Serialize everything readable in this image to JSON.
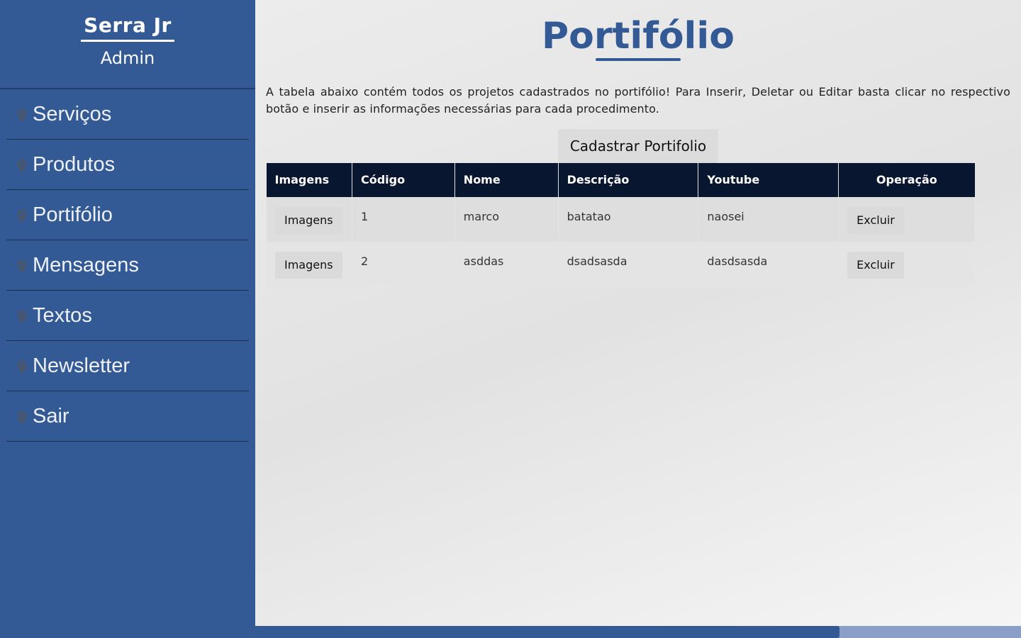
{
  "sidebar": {
    "brand": "Serra Jr",
    "role": "Admin",
    "items": [
      {
        "label": "Serviços",
        "icon": "map-pin-icon"
      },
      {
        "label": "Produtos",
        "icon": "map-pin-icon"
      },
      {
        "label": "Portifólio",
        "icon": "map-pin-icon"
      },
      {
        "label": "Mensagens",
        "icon": "map-pin-icon"
      },
      {
        "label": "Textos",
        "icon": "map-pin-icon"
      },
      {
        "label": "Newsletter",
        "icon": "map-pin-icon"
      },
      {
        "label": "Sair",
        "icon": "map-pin-icon"
      }
    ]
  },
  "main": {
    "title": "Portifólio",
    "intro": "A tabela abaixo contém todos os projetos cadastrados no portifólio! Para Inserir, Deletar ou Editar basta clicar no respectivo botão e inserir as informações necessárias para cada procedimento.",
    "add_button": "Cadastrar Portifolio",
    "table": {
      "headers": [
        "Imagens",
        "Código",
        "Nome",
        "Descrição",
        "Youtube",
        "Operação"
      ],
      "rows": [
        {
          "images_button": "Imagens",
          "codigo": "1",
          "nome": "marco",
          "descricao": "batatao",
          "youtube": "naosei",
          "delete_button": "Excluir"
        },
        {
          "images_button": "Imagens",
          "codigo": "2",
          "nome": "asddas",
          "descricao": "dsadsasda",
          "youtube": "dasdsasda",
          "delete_button": "Excluir"
        }
      ]
    }
  },
  "colors": {
    "sidebar_bg": "#345a96",
    "accent": "#345a96",
    "table_header_bg": "#091630"
  }
}
